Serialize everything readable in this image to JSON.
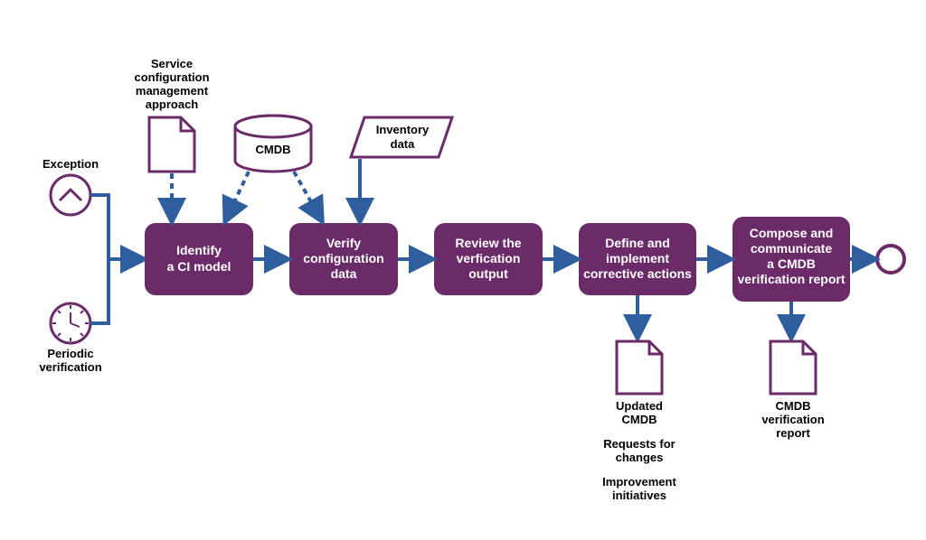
{
  "colors": {
    "purple": "#6b2a68",
    "blue": "#2f5e9e",
    "white": "#ffffff",
    "black": "#000000"
  },
  "triggers": {
    "exception": "Exception",
    "periodic1": "Periodic",
    "periodic2": "verification"
  },
  "inputs": {
    "approach1": "Service",
    "approach2": "configuration",
    "approach3": "management",
    "approach4": "approach",
    "cmdb": "CMDB",
    "inventory1": "Inventory",
    "inventory2": "data"
  },
  "steps": {
    "s1a": "Identify",
    "s1b": "a CI model",
    "s2a": "Verify",
    "s2b": "configuration",
    "s2c": "data",
    "s3a": "Review the",
    "s3b": "verfication",
    "s3c": "output",
    "s4a": "Define and",
    "s4b": "implement",
    "s4c": "corrective actions",
    "s5a": "Compose and",
    "s5b": "communicate",
    "s5c": "a CMDB",
    "s5d": "verification report"
  },
  "outputs": {
    "o1a": "Updated",
    "o1b": "CMDB",
    "o2a": "Requests for",
    "o2b": "changes",
    "o3a": "Improvement",
    "o3b": "initiatives",
    "o4a": "CMDB",
    "o4b": "verification",
    "o4c": "report"
  }
}
